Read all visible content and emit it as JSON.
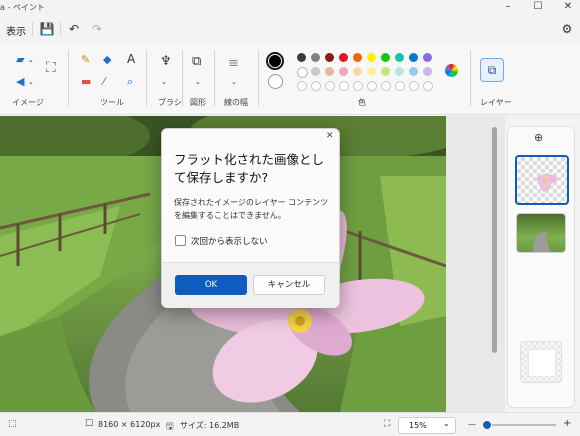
{
  "title": {
    "text": "a - ペイント"
  },
  "window": {
    "minimize_icon": "–",
    "maximize_icon": "☐",
    "close_icon": "✕"
  },
  "menu": {
    "view_label": "表示",
    "save_icon": "💾",
    "undo_icon": "↶",
    "redo_icon": "↷",
    "settings_icon": "⚙"
  },
  "ribbon": {
    "groups": {
      "image": "イメージ",
      "tools": "ツール",
      "brushes": "ブラシ",
      "shapes": "図形",
      "size": "線の幅",
      "colors": "色",
      "layers": "レイヤー"
    },
    "palette_row1": [
      "#3c3c3c",
      "#808080",
      "#8b1a1a",
      "#e81224",
      "#f7630c",
      "#fff100",
      "#16c60c",
      "#0ec6b5",
      "#0078d4",
      "#886ce4"
    ],
    "palette_row2": [
      "#ffffff",
      "#c8c8c8",
      "#e6b8a2",
      "#f4a7b9",
      "#ffd5a0",
      "#f8f2a0",
      "#c5e57a",
      "#b7e6e0",
      "#99c8f0",
      "#c7b8e8"
    ],
    "primary_color": "#000000",
    "secondary_color": "#ffffff",
    "accent": "#0f5cc0"
  },
  "dialog": {
    "title": "フラット化された画像として保存しますか?",
    "body": "保存されたイメージのレイヤー コンテンツを編集することはできません。",
    "checkbox_label": "次回から表示しない",
    "checkbox_checked": false,
    "ok_label": "OK",
    "cancel_label": "キャンセル",
    "close_icon": "✕"
  },
  "layers_panel": {
    "add_icon": "⊕"
  },
  "status": {
    "dimensions": "8160 × 6120px",
    "size": "サイズ: 16.2MB",
    "zoom": "15%",
    "zoom_minus": "—",
    "zoom_plus": "+"
  }
}
